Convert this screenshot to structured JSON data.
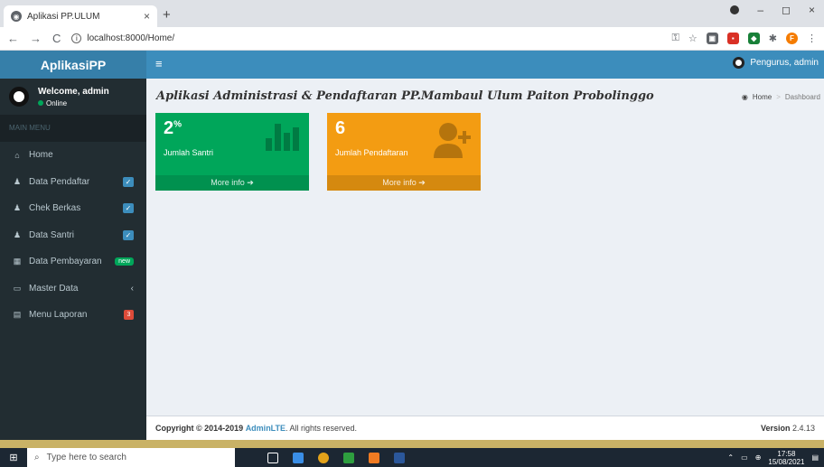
{
  "browser": {
    "tab_title": "Aplikasi PP.ULUM",
    "new_tab": "+",
    "url": "localhost:8000/Home/",
    "back": "←",
    "forward": "→",
    "reload": "C",
    "tab_close": "×",
    "win_min": "–",
    "win_max": "◻",
    "win_close": "×",
    "ext_letter": "F"
  },
  "header": {
    "logo": "AplikasiPP",
    "toggle": "≡",
    "user": "Pengurus, admin"
  },
  "sidebar": {
    "welcome": "Welcome, admin",
    "status": "Online",
    "menu_header": "MAIN MENU",
    "items": [
      {
        "label": "Home",
        "icon": "home-icon",
        "badge": ""
      },
      {
        "label": "Data Pendaftar",
        "icon": "user-icon",
        "badge": "check"
      },
      {
        "label": "Chek Berkas",
        "icon": "user-icon",
        "badge": "check"
      },
      {
        "label": "Data Santri",
        "icon": "user-icon",
        "badge": "check"
      },
      {
        "label": "Data Pembayaran",
        "icon": "table-icon",
        "badge": "new"
      },
      {
        "label": "Master Data",
        "icon": "laptop-icon",
        "badge": "chevron"
      },
      {
        "label": "Menu Laporan",
        "icon": "calendar-icon",
        "badge": "3"
      }
    ]
  },
  "content": {
    "title": "Aplikasi Administrasi & Pendaftaran PP.Mambaul Ulum Paiton Probolinggo",
    "breadcrumb": {
      "home": "Home",
      "current": "Dashboard"
    },
    "boxes": [
      {
        "value": "2",
        "suffix": "%",
        "label": "Jumlah Santri",
        "more": "More info",
        "color": "#00a65a",
        "icon": "bar-chart-icon"
      },
      {
        "value": "6",
        "suffix": "",
        "label": "Jumlah Pendaftaran",
        "more": "More info",
        "color": "#f39c12",
        "icon": "user-plus-icon"
      }
    ]
  },
  "footer": {
    "copyright": "Copyright © 2014-2019",
    "brand": "AdminLTE",
    "rights": ". All rights reserved.",
    "version_label": "Version",
    "version": "2.4.13"
  },
  "taskbar": {
    "search_placeholder": "Type here to search",
    "time": "17:58",
    "date": "15/08/2021"
  },
  "colors": {
    "header": "#3c8dbc",
    "logo_bg": "#367fa9",
    "sidebar": "#222d32",
    "green": "#00a65a",
    "orange": "#f39c12"
  }
}
